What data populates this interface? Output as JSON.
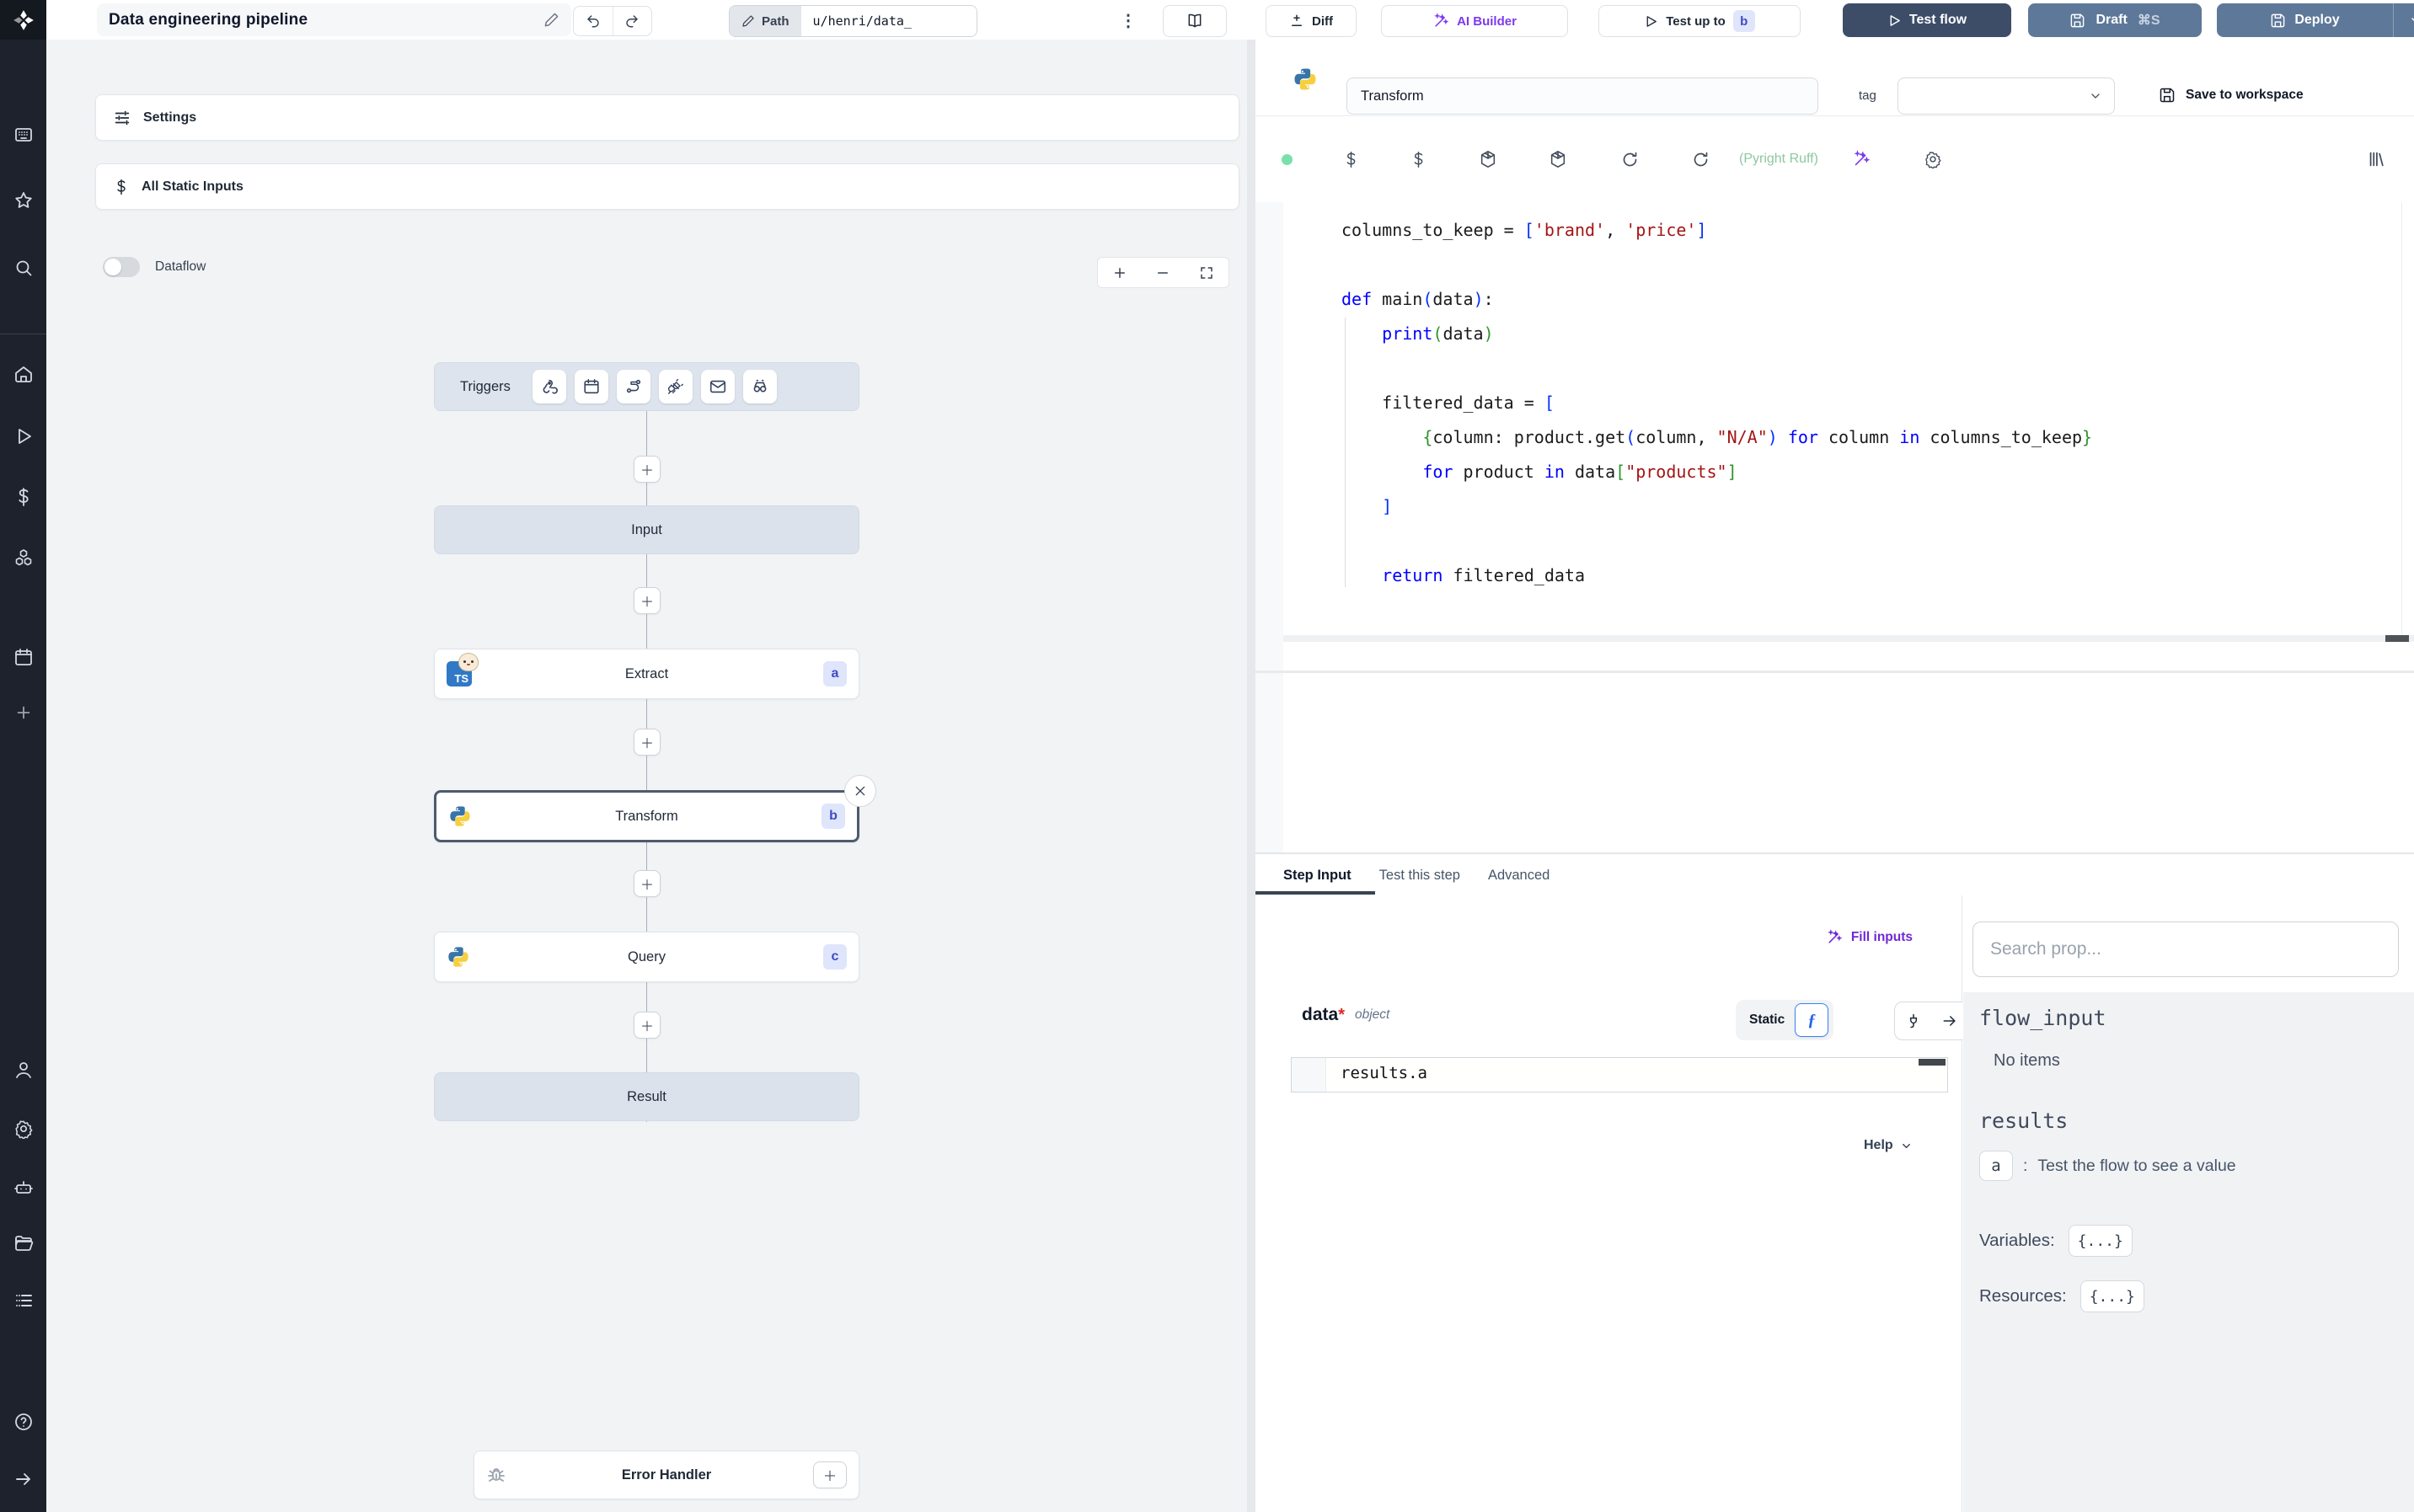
{
  "topbar": {
    "title": "Data engineering pipeline",
    "path_label": "Path",
    "path_value": "u/henri/data_",
    "diff_label": "Diff",
    "ai_builder_label": "AI Builder",
    "test_up_to_label": "Test up to",
    "test_up_to_badge": "b",
    "test_flow_label": "Test flow",
    "draft_label": "Draft",
    "draft_shortcut": "⌘S",
    "deploy_label": "Deploy"
  },
  "flow_panel": {
    "settings_label": "Settings",
    "all_static_inputs_label": "All Static Inputs",
    "dataflow_label": "Dataflow",
    "triggers_label": "Triggers",
    "input_label": "Input",
    "result_label": "Result",
    "error_handler_label": "Error Handler",
    "nodes": [
      {
        "label": "Extract",
        "badge": "a",
        "lang": "typescript-bun"
      },
      {
        "label": "Transform",
        "badge": "b",
        "lang": "python",
        "selected": true
      },
      {
        "label": "Query",
        "badge": "c",
        "lang": "python"
      }
    ]
  },
  "editor": {
    "step_name": "Transform",
    "tag_label": "tag",
    "save_label": "Save to workspace",
    "lint_label": "(Pyright Ruff)",
    "code_lines": [
      [
        [
          "p",
          "columns_to_keep = "
        ],
        [
          "b1",
          "["
        ],
        [
          "s",
          "'brand'"
        ],
        [
          "p",
          ", "
        ],
        [
          "s",
          "'price'"
        ],
        [
          "b1",
          "]"
        ]
      ],
      [],
      [
        [
          "k",
          "def"
        ],
        [
          "p",
          " main"
        ],
        [
          "b1",
          "("
        ],
        [
          "p",
          "data"
        ],
        [
          "b1",
          ")"
        ],
        [
          "p",
          ":"
        ]
      ],
      [
        [
          "p",
          "    "
        ],
        [
          "k",
          "print"
        ],
        [
          "b2",
          "("
        ],
        [
          "p",
          "data"
        ],
        [
          "b2",
          ")"
        ]
      ],
      [],
      [
        [
          "p",
          "    filtered_data = "
        ],
        [
          "b1",
          "["
        ]
      ],
      [
        [
          "p",
          "        "
        ],
        [
          "b2",
          "{"
        ],
        [
          "p",
          "column: product.get"
        ],
        [
          "b1",
          "("
        ],
        [
          "p",
          "column, "
        ],
        [
          "s",
          "\"N/A\""
        ],
        [
          "b1",
          ")"
        ],
        [
          "k",
          " for"
        ],
        [
          "p",
          " column "
        ],
        [
          "k",
          "in"
        ],
        [
          "p",
          " columns_to_keep"
        ],
        [
          "b2",
          "}"
        ]
      ],
      [
        [
          "p",
          "        "
        ],
        [
          "k",
          "for"
        ],
        [
          "p",
          " product "
        ],
        [
          "k",
          "in"
        ],
        [
          "p",
          " data"
        ],
        [
          "b2",
          "["
        ],
        [
          "s",
          "\"products\""
        ],
        [
          "b2",
          "]"
        ]
      ],
      [
        [
          "p",
          "    "
        ],
        [
          "b1",
          "]"
        ]
      ],
      [],
      [
        [
          "p",
          "    "
        ],
        [
          "k",
          "return"
        ],
        [
          "p",
          " filtered_data"
        ]
      ]
    ]
  },
  "bottom": {
    "tabs": [
      "Step Input",
      "Test this step",
      "Advanced"
    ],
    "fill_inputs_label": "Fill inputs",
    "arg_name": "data",
    "arg_required": "*",
    "arg_type": "object",
    "static_label": "Static",
    "expr_value": "results.a",
    "help_label": "Help"
  },
  "props_panel": {
    "search_placeholder": "Search prop...",
    "flow_input_label": "flow_input",
    "no_items_label": "No items",
    "results_label": "results",
    "result_key": "a",
    "result_separator": ":",
    "result_hint": "Test the flow to see a value",
    "variables_label": "Variables:",
    "variables_value": "{...}",
    "resources_label": "Resources:",
    "resources_value": "{...}"
  },
  "colors": {
    "accent_purple": "#6d28d9",
    "brand_dark": "#1d222c",
    "test_flow_bg": "#3d4d68",
    "deploy_bg": "#5e7899",
    "node_badge_bg": "#dfe5fb",
    "node_badge_text": "#3f4bc4",
    "lint_green": "#8cc8a0",
    "status_green": "#7ae0a9"
  }
}
